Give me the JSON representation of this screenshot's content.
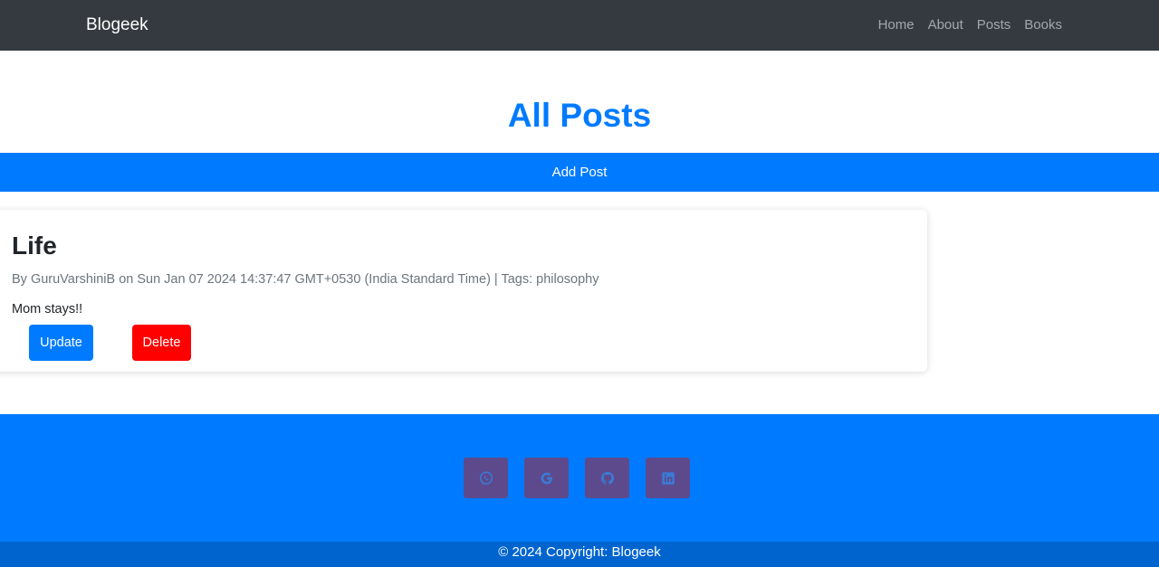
{
  "navbar": {
    "brand": "Blogeek",
    "links": [
      "Home",
      "About",
      "Posts",
      "Books"
    ]
  },
  "page_title": "All Posts",
  "add_post_label": "Add Post",
  "post": {
    "title": "Life",
    "meta": "By GuruVarshiniB on Sun Jan 07 2024 14:37:47 GMT+0530 (India Standard Time) | Tags: philosophy",
    "body": "Mom stays!!",
    "update_label": "Update",
    "delete_label": "Delete"
  },
  "footer": {
    "social_icons": [
      "whatsapp-icon",
      "google-icon",
      "github-icon",
      "linkedin-icon"
    ],
    "copyright": "© 2024 Copyright: Blogeek"
  },
  "colors": {
    "navbar_bg": "#343a40",
    "primary": "#007bff",
    "danger": "#ff0000",
    "social_button": "#5c4a8d",
    "copyright_bar": "#0064cf"
  }
}
